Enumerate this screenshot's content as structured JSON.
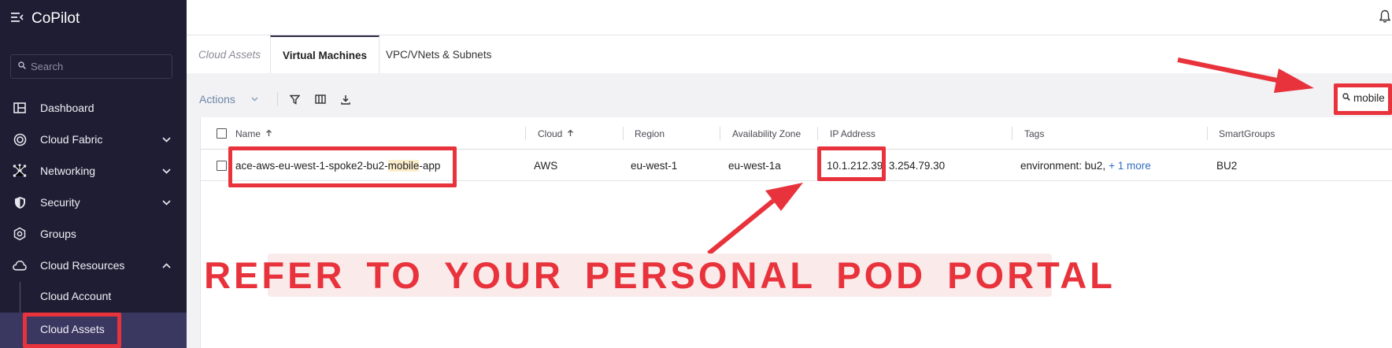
{
  "app": {
    "title": "CoPilot"
  },
  "sidebar": {
    "search_placeholder": "Search",
    "items": [
      {
        "label": "Dashboard"
      },
      {
        "label": "Cloud Fabric"
      },
      {
        "label": "Networking"
      },
      {
        "label": "Security"
      },
      {
        "label": "Groups"
      },
      {
        "label": "Cloud Resources"
      }
    ],
    "subitems": [
      {
        "label": "Cloud Account"
      },
      {
        "label": "Cloud Assets"
      }
    ]
  },
  "tabs": [
    {
      "label": "Cloud Assets"
    },
    {
      "label": "Virtual Machines"
    },
    {
      "label": "VPC/VNets & Subnets"
    }
  ],
  "toolbar": {
    "actions_label": "Actions"
  },
  "search": {
    "value": "mobile"
  },
  "table": {
    "columns": [
      "Name",
      "Cloud",
      "Region",
      "Availability Zone",
      "IP Address",
      "Tags",
      "SmartGroups"
    ],
    "rows": [
      {
        "name_prefix": "ace-aws-eu-west-1-spoke2-bu2-",
        "name_match": "mobile",
        "name_suffix": "-app",
        "cloud": "AWS",
        "region": "eu-west-1",
        "az": "eu-west-1a",
        "ip_primary": "10.1.212.39",
        "ip_rest": ", 3.254.79.30",
        "tags": "environment: bu2,",
        "tags_more": "+ 1 more",
        "smartgroups": "BU2"
      }
    ]
  },
  "annotation": {
    "banner_text": "REFER TO YOUR PERSONAL POD PORTAL"
  },
  "colors": {
    "sidebar_bg": "#1f1d33",
    "annotation_red": "#e8333c",
    "link_blue": "#2f6fbf",
    "highlight": "#fbeecb"
  }
}
